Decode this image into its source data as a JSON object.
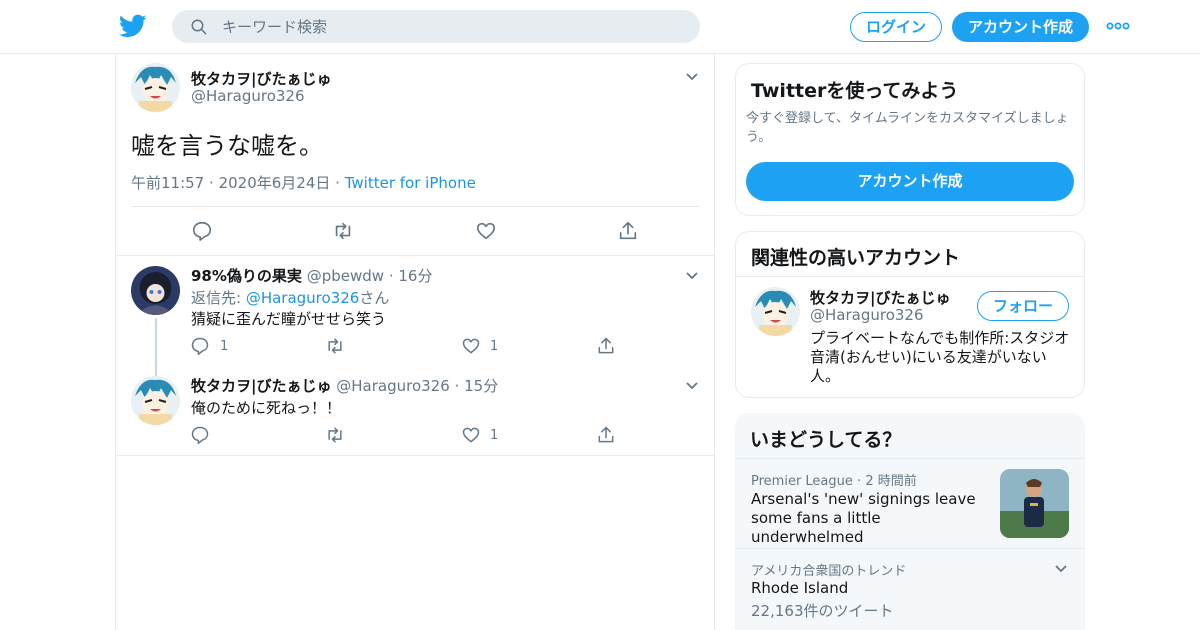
{
  "header": {
    "search_placeholder": "キーワード検索",
    "login_label": "ログイン",
    "signup_label": "アカウント作成",
    "brand_color": "#1da1f2"
  },
  "main_tweet": {
    "name": "牧タカヲ|びたぁじゅ",
    "handle": "@Haraguro326",
    "text": "嘘を言うな嘘を。",
    "time": "午前11:57",
    "date": "2020年6月24日",
    "source": "Twitter for iPhone",
    "separator": "·"
  },
  "replies": [
    {
      "name": "98%偽りの果実",
      "handle": "@pbewdw",
      "time": "16分",
      "reply_prefix": "返信先: ",
      "reply_to": "@Haraguro326",
      "reply_suffix": "さん",
      "text": "猜疑に歪んだ瞳がせせら笑う",
      "reply_count": "1",
      "like_count": "1"
    },
    {
      "name": "牧タカヲ|びたぁじゅ",
      "handle": "@Haraguro326",
      "time": "15分",
      "text": "俺のために死ねっ！！",
      "like_count": "1"
    }
  ],
  "sidebar": {
    "signup_card": {
      "title": "Twitterを使ってみよう",
      "description": "今すぐ登録して、タイムラインをカスタマイズしましょう。",
      "button_label": "アカウント作成"
    },
    "related_accounts": {
      "title": "関連性の高いアカウント",
      "name": "牧タカヲ|びたぁじゅ",
      "handle": "@Haraguro326",
      "follow_label": "フォロー",
      "bio": "プライベートなんでも制作所:スタジオ音清(おんせい)にいる友達がいない人。"
    },
    "trends": {
      "title": "いまどうしてる？",
      "items": [
        {
          "category": "Premier League",
          "time": "2 時間前",
          "headline": "Arsenal's 'new' signings leave some fans a little underwhelmed"
        },
        {
          "category": "アメリカ合衆国のトレンド",
          "headline": "Rhode Island",
          "count": "22,163件のツイート"
        }
      ]
    }
  }
}
